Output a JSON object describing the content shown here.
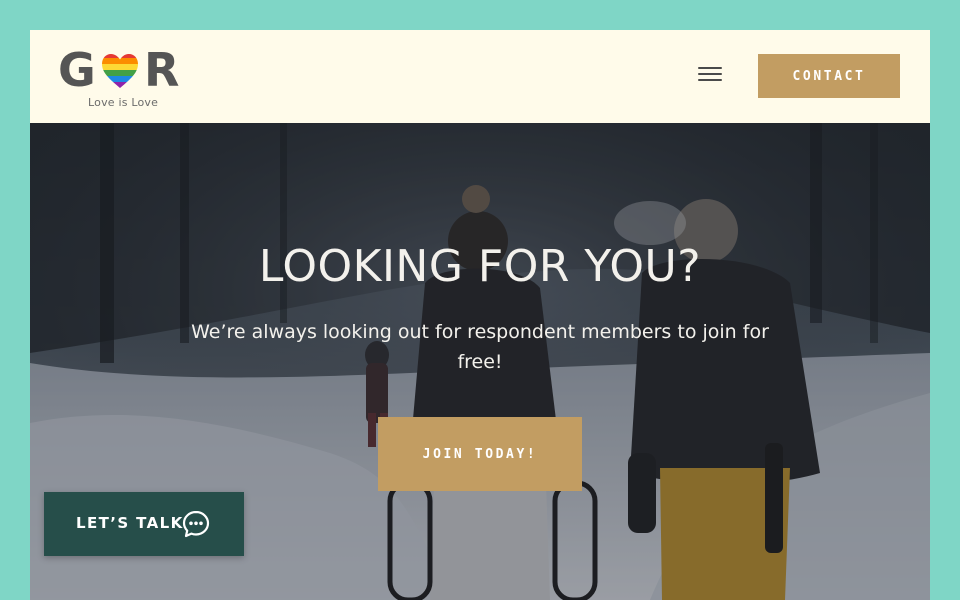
{
  "header": {
    "logo": {
      "letters": "GR",
      "tagline": "Love is Love"
    },
    "menu_icon": "hamburger-menu-icon",
    "contact_label": "CONTACT"
  },
  "hero": {
    "title": "LOOKING FOR YOU?",
    "subtitle": "We’re always looking out for respondent members to join for free!",
    "join_label": "JOIN TODAY!",
    "background": "winter-hikers-snow-photo"
  },
  "chat": {
    "label": "LET’S TALK",
    "icon": "chat-bubble-icon"
  },
  "colors": {
    "page_border": "#7fd6c6",
    "header_bg": "#fffbea",
    "accent_gold": "#c29d62",
    "chat_green": "#264e4a",
    "logo_gray": "#555555"
  }
}
